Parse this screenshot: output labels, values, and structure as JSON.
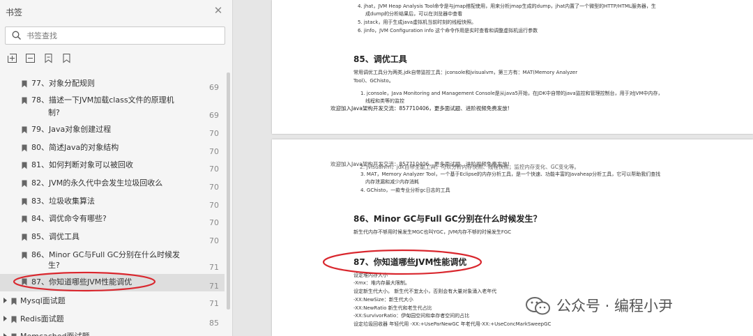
{
  "sidebar": {
    "title": "书签",
    "search_placeholder": "书签查找",
    "items": [
      {
        "label": "77、对象分配规则",
        "page": "69"
      },
      {
        "label": "78、描述一下JVM加载class文件的原理机",
        "label2": "制?",
        "page": "69"
      },
      {
        "label": "79、Java对象创建过程",
        "page": "70"
      },
      {
        "label": "80、简述Java的对象结构",
        "page": "70"
      },
      {
        "label": "81、如何判断对象可以被回收",
        "page": "70"
      },
      {
        "label": "82、JVM的永久代中会发生垃圾回收么",
        "page": "70"
      },
      {
        "label": "83、垃圾收集算法",
        "page": "70"
      },
      {
        "label": "84、调优命令有哪些?",
        "page": "70"
      },
      {
        "label": "85、调优工具",
        "page": "70"
      },
      {
        "label": "86、Minor GC与Full GC分别在什么时候发",
        "label2": "生?",
        "page": "71"
      },
      {
        "label": "87、你知道哪些JVM性能调优",
        "page": "71"
      },
      {
        "label": "Mysql面试题",
        "page": "71"
      },
      {
        "label": "Redis面试题",
        "page": "85"
      },
      {
        "label": "Memcached面试题",
        "page": ""
      }
    ]
  },
  "page1": {
    "lines_top": [
      "4. jhat，JVM Heap Analysis Tool命令是与jmap搭配使用，用来分析jmap生成的dump，jhat内置了一个微型的HTTP/HTML服务器，生",
      "成dump的分析结果后，可以在浏览器中查看",
      "5. jstack，用于生成java虚拟机当前时刻的线程快照。",
      "6. jinfo，JVM Configuration info 这个命令作用是实时查看和调整虚拟机运行参数"
    ],
    "heading": "85、调优工具",
    "para": [
      "常用调优工具分为两类,jdk自带监控工具：jconsole和jvisualvm，第三方有：MAT(Memory Analyzer",
      "Tool)、GChisto。"
    ],
    "list": [
      "1. jconsole，Java Monitoring and Management Console是从java5开始，在JDK中自带的java监控和管理控制台，用于对JVM中内存，",
      "线程和类等的监控"
    ],
    "watermark": "欢迎加入Java架构开发交流：857710406，更多面试题、进阶视频免费发放!"
  },
  "page2": {
    "overlap_a": "欢迎加入Java架构开发交流：857710406，更多面试题、进阶视频免费发放!",
    "overlap_b": "2. jvisualvm，jdk自带全能工具，可以分析内存快照、线程快照；监控内存变化、GC变化等。",
    "list": [
      "3. MAT，Memory Analyzer Tool，一个基于Eclipse的内存分析工具，是一个快速、功能丰富的Javaheap分析工具，它可以帮助我们查找",
      "内存泄漏和减少内存消耗",
      "4. GChisto，一款专业分析gc日志的工具"
    ],
    "heading86": "86、Minor GC与Full GC分别在什么时候发生？",
    "para86": "新生代内存不够用时候发生MGC也叫YGC，JVM内存不够的时候发生FGC",
    "heading87": "87、你知道哪些JVM性能调优",
    "tuning": [
      "设定堆内存大小",
      "-Xmx：堆内存最大限制。",
      "设定新生代大小。 新生代不宜太小，否则会有大量对象涌入老年代",
      "-XX:NewSize：新生代大小",
      "-XX:NewRatio 新生代和老生代占比",
      "-XX:SurvivorRatio：伊甸园空间和幸存者空间的占比",
      "设定垃圾回收器 年轻代用 -XX:+UseParNewGC 年老代用-XX:+UseConcMarkSweepGC"
    ]
  },
  "watermark": {
    "text": "公众号 · 编程小尹"
  },
  "colors": {
    "highlight_ellipse": "#d9272e",
    "selected_row": "#dedede"
  },
  "icons": [
    "close-icon",
    "search-icon",
    "expand-all-icon",
    "collapse-all-icon",
    "bookmark-add-icon",
    "bookmark-icon",
    "wechat-icon"
  ]
}
